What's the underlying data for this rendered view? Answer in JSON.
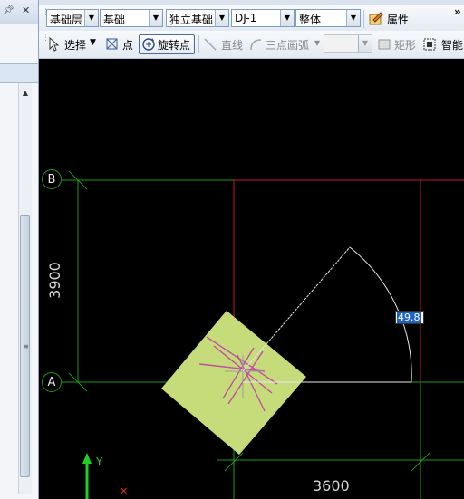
{
  "left_panel": {
    "pin_icon": "pin-icon",
    "close_icon": "close-icon",
    "grip_symbol": "≡"
  },
  "toolbar1": {
    "layer_value": "基础层",
    "category_value": "基础",
    "type_value": "独立基础",
    "component_value": "DJ-1",
    "scope_value": "整体",
    "properties_label": "属性",
    "overflow_symbol": "»"
  },
  "toolbar2": {
    "select_label": "选择",
    "point_label": "点",
    "rotate_point_label": "旋转点",
    "line_label": "直线",
    "arc_label": "三点画弧",
    "arc_dd_symbol": "▾",
    "rect_label": "矩形",
    "smart_label": "智能"
  },
  "canvas": {
    "axis_b": "B",
    "axis_a": "A",
    "dim_vertical": "3900",
    "dim_horizontal": "3600",
    "angle_value": "49.8",
    "ucs_y": "Y",
    "colors": {
      "background": "#000000",
      "axis_green": "#1a9a1a",
      "grid_red": "#c8192a",
      "footing_fill": "#c6dc7a",
      "rebar_magenta": "#c050a0"
    }
  }
}
